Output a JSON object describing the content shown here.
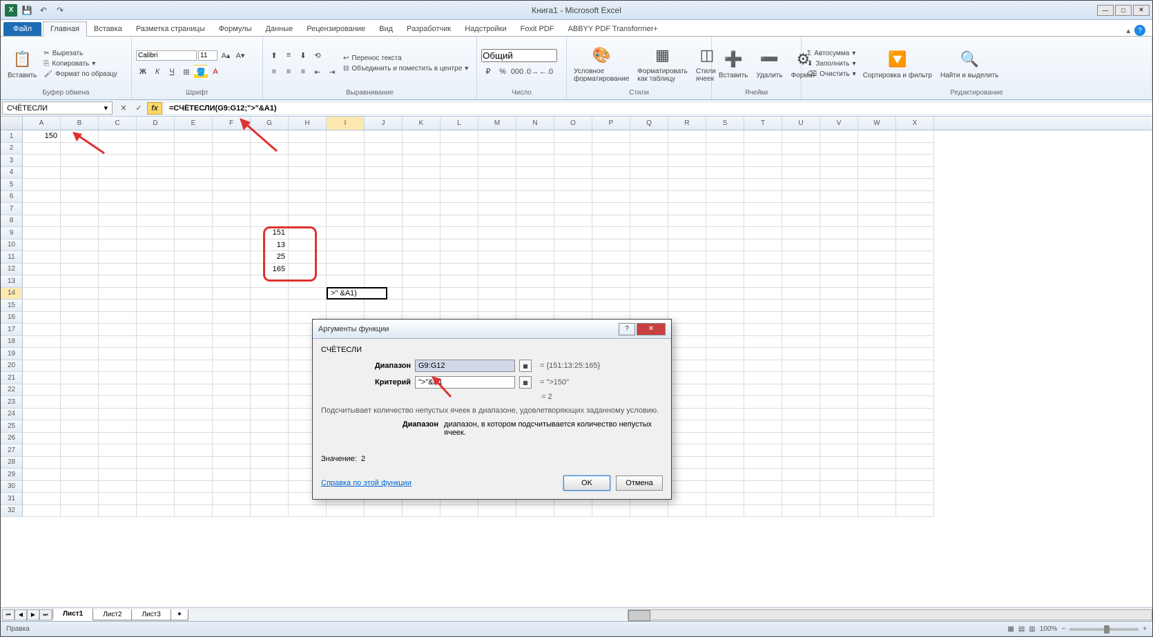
{
  "window": {
    "title": "Книга1 - Microsoft Excel"
  },
  "tabs": {
    "file": "Файл",
    "items": [
      "Главная",
      "Вставка",
      "Разметка страницы",
      "Формулы",
      "Данные",
      "Рецензирование",
      "Вид",
      "Разработчик",
      "Надстройки",
      "Foxit PDF",
      "ABBYY PDF Transformer+"
    ],
    "activeIndex": 0
  },
  "ribbon": {
    "clipboard": {
      "label": "Буфер обмена",
      "paste": "Вставить",
      "cut": "Вырезать",
      "copy": "Копировать",
      "format": "Формат по образцу"
    },
    "font": {
      "label": "Шрифт",
      "name": "Calibri",
      "size": "11"
    },
    "align": {
      "label": "Выравнивание",
      "wrap": "Перенос текста",
      "merge": "Объединить и поместить в центре"
    },
    "number": {
      "label": "Число",
      "format": "Общий"
    },
    "styles": {
      "label": "Стили",
      "cond": "Условное форматирование",
      "table": "Форматировать как таблицу",
      "cell": "Стили ячеек"
    },
    "cells": {
      "label": "Ячейки",
      "insert": "Вставить",
      "delete": "Удалить",
      "format": "Формат"
    },
    "editing": {
      "label": "Редактирование",
      "sum": "Автосумма",
      "fill": "Заполнить",
      "clear": "Очистить",
      "sort": "Сортировка и фильтр",
      "find": "Найти и выделить"
    }
  },
  "namebox": "СЧЁТЕСЛИ",
  "formula": "=СЧЁТЕСЛИ(G9:G12;\">\"&A1)",
  "cells": {
    "A1": "150",
    "G9": "151",
    "G10": "13",
    "G11": "25",
    "G12": "165",
    "I14_edit": ">\" &A1)"
  },
  "columns": [
    "A",
    "B",
    "C",
    "D",
    "E",
    "F",
    "G",
    "H",
    "I",
    "J",
    "K",
    "L",
    "M",
    "N",
    "O",
    "P",
    "Q",
    "R",
    "S",
    "T",
    "U",
    "V",
    "W",
    "X"
  ],
  "rowCount": 32,
  "sheets": {
    "items": [
      "Лист1",
      "Лист2",
      "Лист3"
    ],
    "active": 0
  },
  "status": {
    "mode": "Правка",
    "zoom": "100%"
  },
  "dialog": {
    "title": "Аргументы функции",
    "func": "СЧЁТЕСЛИ",
    "range_label": "Диапазон",
    "range_value": "G9:G12",
    "range_result": "= {151:13:25:165}",
    "crit_label": "Критерий",
    "crit_value": "\">\"&A1",
    "crit_result": "= \">150\"",
    "formula_result": "= 2",
    "desc": "Подсчитывает количество непустых ячеек в диапазоне, удовлетворяющих заданному условию.",
    "arg_label": "Диапазон",
    "arg_desc": "диапазон, в котором подсчитывается количество непустых ячеек.",
    "value_label": "Значение:",
    "value": "2",
    "help": "Справка по этой функции",
    "ok": "OK",
    "cancel": "Отмена"
  }
}
